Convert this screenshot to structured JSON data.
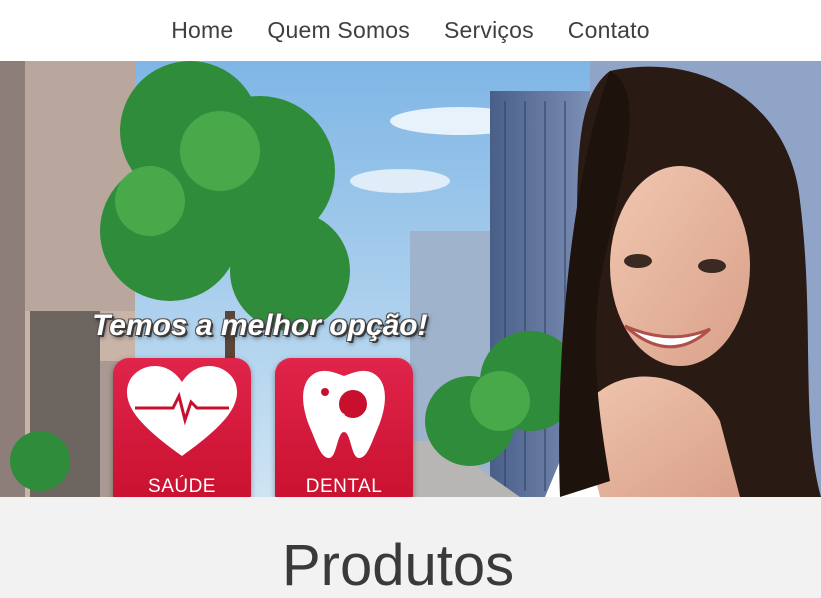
{
  "nav": {
    "items": [
      {
        "label": "Home"
      },
      {
        "label": "Quem Somos"
      },
      {
        "label": "Serviços"
      },
      {
        "label": "Contato"
      }
    ]
  },
  "hero": {
    "tagline": "Temos a melhor opção!",
    "cards": [
      {
        "label": "SAÚDE",
        "icon": "heart-pulse-icon"
      },
      {
        "label": "DENTAL",
        "icon": "tooth-magnifier-icon"
      }
    ],
    "slide_count": 4,
    "accent_color": "#d01030"
  },
  "section": {
    "title": "Produtos"
  }
}
